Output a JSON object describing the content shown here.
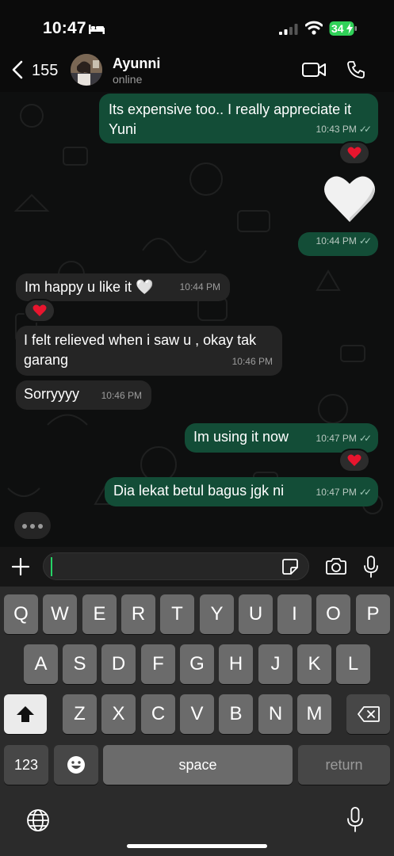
{
  "status": {
    "time": "10:47",
    "battery": "34"
  },
  "header": {
    "back_count": "155",
    "contact_name": "Ayunni",
    "contact_status": "online"
  },
  "messages": [
    {
      "direction": "out",
      "lines": [
        "Its expensive too.. I really appreciate it",
        "Yuni"
      ],
      "time": "10:43 PM",
      "reaction": "red-heart"
    },
    {
      "direction": "out",
      "text": "🤍",
      "time": "10:44 PM"
    },
    {
      "direction": "in",
      "text": "Im happy u like it 🤍",
      "time": "10:44 PM",
      "reaction": "red-heart"
    },
    {
      "direction": "in",
      "lines": [
        "I felt relieved when i saw u , okay tak",
        "garang"
      ],
      "time": "10:46 PM"
    },
    {
      "direction": "in",
      "text": "Sorryyyy",
      "time": "10:46 PM"
    },
    {
      "direction": "out",
      "text": "Im using it now",
      "time": "10:47 PM",
      "reaction": "red-heart"
    },
    {
      "direction": "out",
      "text": "Dia lekat betul bagus jgk ni",
      "time": "10:47 PM"
    }
  ],
  "input": {
    "value": ""
  },
  "keyboard": {
    "row1": [
      "Q",
      "W",
      "E",
      "R",
      "T",
      "Y",
      "U",
      "I",
      "O",
      "P"
    ],
    "row2": [
      "A",
      "S",
      "D",
      "F",
      "G",
      "H",
      "J",
      "K",
      "L"
    ],
    "row3": [
      "Z",
      "X",
      "C",
      "V",
      "B",
      "N",
      "M"
    ],
    "numbers_label": "123",
    "space_label": "space",
    "return_label": "return"
  },
  "colors": {
    "outgoing_bubble": "#134d37",
    "incoming_bubble": "#252525",
    "accent": "#25d366"
  }
}
